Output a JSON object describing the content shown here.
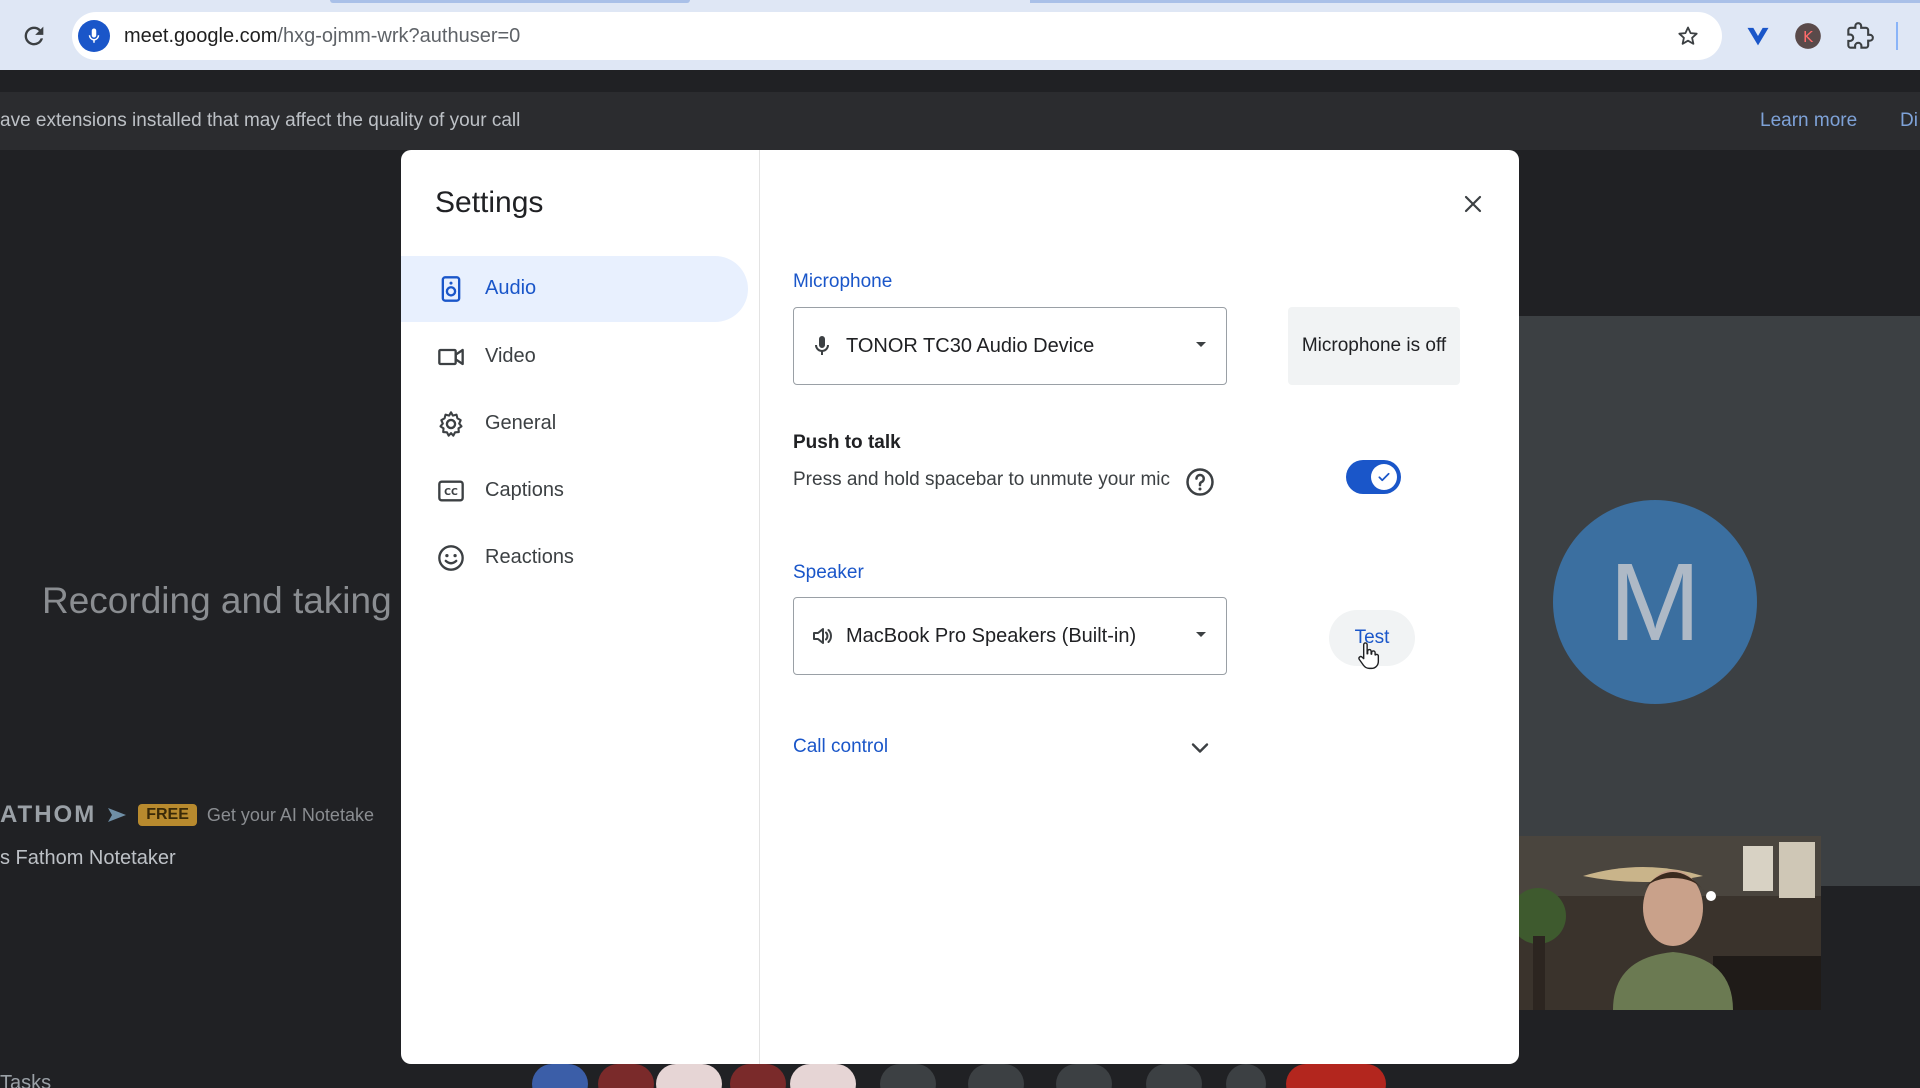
{
  "browser": {
    "url_host": "meet.google.com",
    "url_path": "/hxg-ojmm-wrk?authuser=0"
  },
  "banner": {
    "text": "ave extensions installed that may affect the quality of your call",
    "learn_more": "Learn more",
    "dismiss": "Di"
  },
  "meeting": {
    "recording_text": "Recording and taking",
    "fathom_logo": "ATHOM",
    "fathom_badge": "FREE",
    "fathom_tagline": "Get your AI Notetake",
    "notetaker_name": "s Fathom Notetaker",
    "avatar_initial": "M",
    "tasks": "Tasks"
  },
  "settings": {
    "title": "Settings",
    "nav": [
      {
        "label": "Audio",
        "icon": "speaker-icon",
        "active": true
      },
      {
        "label": "Video",
        "icon": "video-icon",
        "active": false
      },
      {
        "label": "General",
        "icon": "gear-icon",
        "active": false
      },
      {
        "label": "Captions",
        "icon": "cc-icon",
        "active": false
      },
      {
        "label": "Reactions",
        "icon": "smiley-icon",
        "active": false
      }
    ],
    "microphone": {
      "label": "Microphone",
      "selected": "TONOR TC30 Audio Device",
      "status": "Microphone is off"
    },
    "push_to_talk": {
      "title": "Push to talk",
      "description": "Press and hold spacebar to unmute your mic",
      "enabled": true
    },
    "speaker": {
      "label": "Speaker",
      "selected": "MacBook Pro Speakers (Built-in)",
      "test_label": "Test"
    },
    "call_control": {
      "label": "Call control"
    }
  },
  "colors": {
    "accent": "#1a56c9",
    "active_nav_bg": "#e8f0fe",
    "backdrop": "#202124"
  }
}
